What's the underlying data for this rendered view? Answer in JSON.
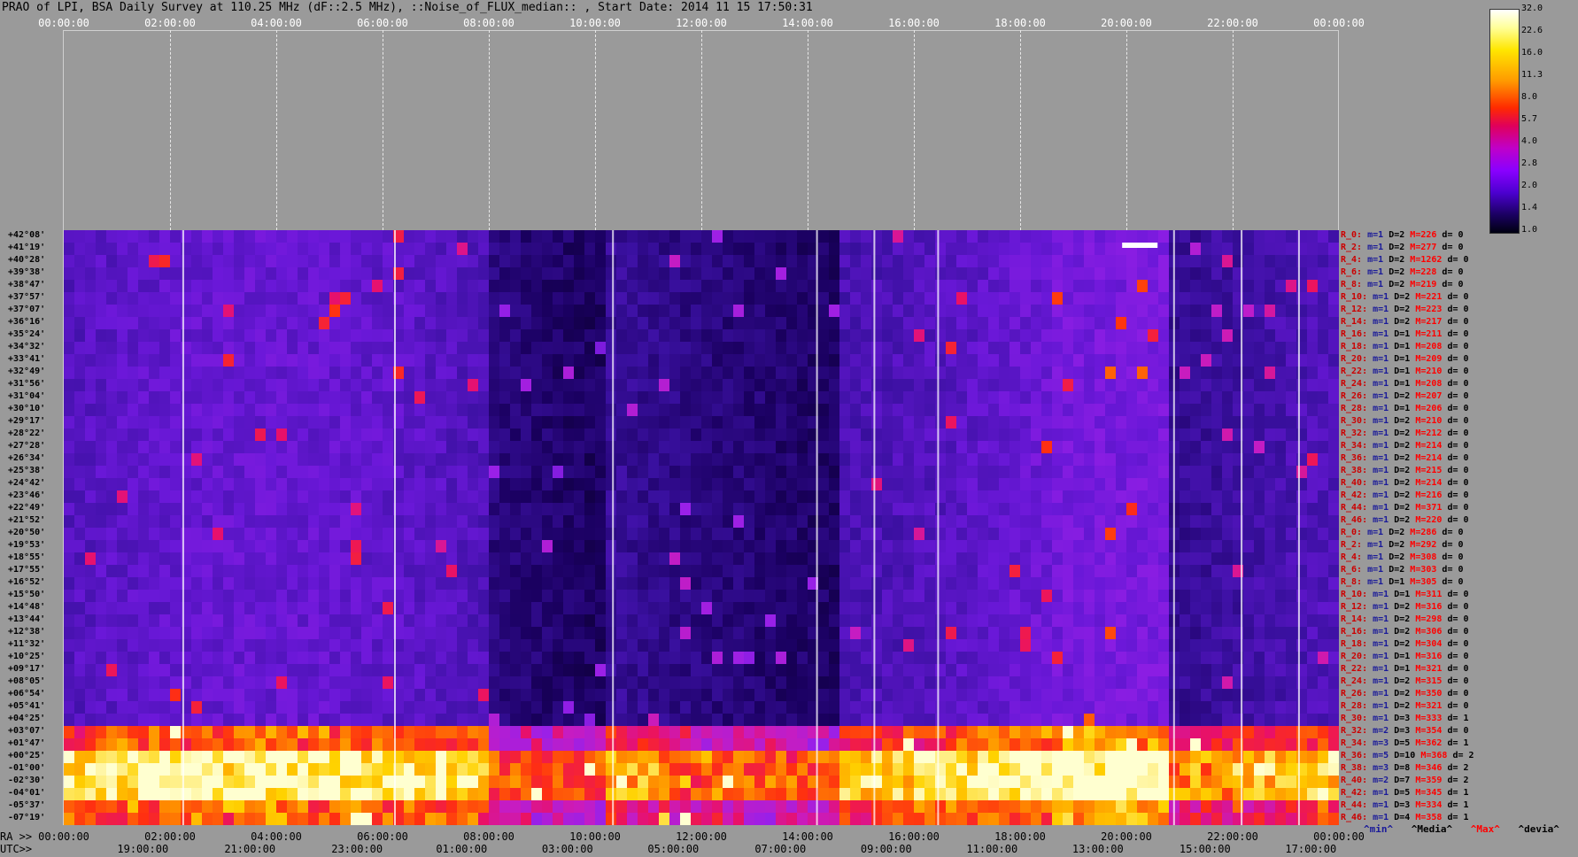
{
  "title": "PRAO of LPI, BSA Daily Survey at 110.25 MHz (dF::2.5 MHz), ::Noise_of_FLUX_median:: , Start Date: 2014 11 15 17:50:31",
  "top_axis_ticks": [
    "00:00:00",
    "02:00:00",
    "04:00:00",
    "06:00:00",
    "08:00:00",
    "10:00:00",
    "12:00:00",
    "14:00:00",
    "16:00:00",
    "18:00:00",
    "20:00:00",
    "22:00:00",
    "00:00:00"
  ],
  "ra_axis": {
    "label": "RA >>",
    "ticks": [
      "00:00:00",
      "02:00:00",
      "04:00:00",
      "06:00:00",
      "08:00:00",
      "10:00:00",
      "12:00:00",
      "14:00:00",
      "16:00:00",
      "18:00:00",
      "20:00:00",
      "22:00:00",
      "00:00:00"
    ]
  },
  "utc_axis": {
    "label": "UTC>>",
    "ticks": [
      "19:00:00",
      "21:00:00",
      "23:00:00",
      "01:00:00",
      "03:00:00",
      "05:00:00",
      "07:00:00",
      "09:00:00",
      "11:00:00",
      "13:00:00",
      "15:00:00",
      "17:00:00"
    ]
  },
  "legend_row": {
    "min": "^min^",
    "median": "^Media^",
    "max": "^Max^",
    "devia": "^devia^"
  },
  "colors": {
    "background": "#9a9a9a",
    "min": "#1a1a99",
    "max": "#ff0000",
    "row_index": "#cc0000"
  },
  "chart_data": {
    "type": "heatmap",
    "title": "PRAO of LPI, BSA Daily Survey at 110.25 MHz (dF::2.5 MHz), ::Noise_of_FLUX_median:: , Start Date: 2014 11 15 17:50:31",
    "x_axis": "RA 00:00:00 to 24:00:00",
    "colorbar": {
      "ticks": [
        "32.0",
        "22.6",
        "16.0",
        "11.3",
        "8.0",
        "5.7",
        "4.0",
        "2.8",
        "2.0",
        "1.4",
        "1.0"
      ],
      "scale": "log"
    },
    "declinations": [
      "+42°08'",
      "+41°19'",
      "+40°28'",
      "+39°38'",
      "+38°47'",
      "+37°57'",
      "+37°07'",
      "+36°16'",
      "+35°24'",
      "+34°32'",
      "+33°41'",
      "+32°49'",
      "+31°56'",
      "+31°04'",
      "+30°10'",
      "+29°17'",
      "+28°22'",
      "+27°28'",
      "+26°34'",
      "+25°38'",
      "+24°42'",
      "+23°46'",
      "+22°49'",
      "+21°52'",
      "+20°50'",
      "+19°53'",
      "+18°55'",
      "+17°55'",
      "+16°52'",
      "+15°50'",
      "+14°48'",
      "+13°44'",
      "+12°38'",
      "+11°32'",
      "+10°25'",
      "+09°17'",
      "+08°05'",
      "+06°54'",
      "+05°41'",
      "+04°25'",
      "+03°07'",
      "+01°47'",
      "+00°25'",
      "-01°00'",
      "-02°30'",
      "-04°01'",
      "-05°37'",
      "-07°19'"
    ],
    "row_stats": [
      {
        "r": "R_0:",
        "m": "m=1",
        "D": "D=2",
        "M": "M=226",
        "d": "d= 0"
      },
      {
        "r": "R_2:",
        "m": "m=1",
        "D": "D=2",
        "M": "M=277",
        "d": "d= 0"
      },
      {
        "r": "R_4:",
        "m": "m=1",
        "D": "D=2",
        "M": "M=1262",
        "d": "d= 0"
      },
      {
        "r": "R_6:",
        "m": "m=1",
        "D": "D=2",
        "M": "M=228",
        "d": "d= 0"
      },
      {
        "r": "R_8:",
        "m": "m=1",
        "D": "D=2",
        "M": "M=219",
        "d": "d= 0"
      },
      {
        "r": "R_10:",
        "m": "m=1",
        "D": "D=2",
        "M": "M=221",
        "d": "d= 0"
      },
      {
        "r": "R_12:",
        "m": "m=1",
        "D": "D=2",
        "M": "M=223",
        "d": "d= 0"
      },
      {
        "r": "R_14:",
        "m": "m=1",
        "D": "D=2",
        "M": "M=217",
        "d": "d= 0"
      },
      {
        "r": "R_16:",
        "m": "m=1",
        "D": "D=1",
        "M": "M=211",
        "d": "d= 0"
      },
      {
        "r": "R_18:",
        "m": "m=1",
        "D": "D=1",
        "M": "M=208",
        "d": "d= 0"
      },
      {
        "r": "R_20:",
        "m": "m=1",
        "D": "D=1",
        "M": "M=209",
        "d": "d= 0"
      },
      {
        "r": "R_22:",
        "m": "m=1",
        "D": "D=1",
        "M": "M=210",
        "d": "d= 0"
      },
      {
        "r": "R_24:",
        "m": "m=1",
        "D": "D=1",
        "M": "M=208",
        "d": "d= 0"
      },
      {
        "r": "R_26:",
        "m": "m=1",
        "D": "D=2",
        "M": "M=207",
        "d": "d= 0"
      },
      {
        "r": "R_28:",
        "m": "m=1",
        "D": "D=1",
        "M": "M=206",
        "d": "d= 0"
      },
      {
        "r": "R_30:",
        "m": "m=1",
        "D": "D=2",
        "M": "M=210",
        "d": "d= 0"
      },
      {
        "r": "R_32:",
        "m": "m=1",
        "D": "D=2",
        "M": "M=212",
        "d": "d= 0"
      },
      {
        "r": "R_34:",
        "m": "m=1",
        "D": "D=2",
        "M": "M=214",
        "d": "d= 0"
      },
      {
        "r": "R_36:",
        "m": "m=1",
        "D": "D=2",
        "M": "M=214",
        "d": "d= 0"
      },
      {
        "r": "R_38:",
        "m": "m=1",
        "D": "D=2",
        "M": "M=215",
        "d": "d= 0"
      },
      {
        "r": "R_40:",
        "m": "m=1",
        "D": "D=2",
        "M": "M=214",
        "d": "d= 0"
      },
      {
        "r": "R_42:",
        "m": "m=1",
        "D": "D=2",
        "M": "M=216",
        "d": "d= 0"
      },
      {
        "r": "R_44:",
        "m": "m=1",
        "D": "D=2",
        "M": "M=371",
        "d": "d= 0"
      },
      {
        "r": "R_46:",
        "m": "m=1",
        "D": "D=2",
        "M": "M=220",
        "d": "d= 0"
      },
      {
        "r": "R_0:",
        "m": "m=1",
        "D": "D=2",
        "M": "M=286",
        "d": "d= 0"
      },
      {
        "r": "R_2:",
        "m": "m=1",
        "D": "D=2",
        "M": "M=292",
        "d": "d= 0"
      },
      {
        "r": "R_4:",
        "m": "m=1",
        "D": "D=2",
        "M": "M=308",
        "d": "d= 0"
      },
      {
        "r": "R_6:",
        "m": "m=1",
        "D": "D=2",
        "M": "M=303",
        "d": "d= 0"
      },
      {
        "r": "R_8:",
        "m": "m=1",
        "D": "D=1",
        "M": "M=305",
        "d": "d= 0"
      },
      {
        "r": "R_10:",
        "m": "m=1",
        "D": "D=1",
        "M": "M=311",
        "d": "d= 0"
      },
      {
        "r": "R_12:",
        "m": "m=1",
        "D": "D=2",
        "M": "M=316",
        "d": "d= 0"
      },
      {
        "r": "R_14:",
        "m": "m=1",
        "D": "D=2",
        "M": "M=298",
        "d": "d= 0"
      },
      {
        "r": "R_16:",
        "m": "m=1",
        "D": "D=2",
        "M": "M=306",
        "d": "d= 0"
      },
      {
        "r": "R_18:",
        "m": "m=1",
        "D": "D=2",
        "M": "M=304",
        "d": "d= 0"
      },
      {
        "r": "R_20:",
        "m": "m=1",
        "D": "D=1",
        "M": "M=316",
        "d": "d= 0"
      },
      {
        "r": "R_22:",
        "m": "m=1",
        "D": "D=1",
        "M": "M=321",
        "d": "d= 0"
      },
      {
        "r": "R_24:",
        "m": "m=1",
        "D": "D=2",
        "M": "M=315",
        "d": "d= 0"
      },
      {
        "r": "R_26:",
        "m": "m=1",
        "D": "D=2",
        "M": "M=350",
        "d": "d= 0"
      },
      {
        "r": "R_28:",
        "m": "m=1",
        "D": "D=2",
        "M": "M=321",
        "d": "d= 0"
      },
      {
        "r": "R_30:",
        "m": "m=1",
        "D": "D=3",
        "M": "M=333",
        "d": "d= 1"
      },
      {
        "r": "R_32:",
        "m": "m=2",
        "D": "D=3",
        "M": "M=354",
        "d": "d= 0"
      },
      {
        "r": "R_34:",
        "m": "m=3",
        "D": "D=5",
        "M": "M=362",
        "d": "d= 1"
      },
      {
        "r": "R_36:",
        "m": "m=5",
        "D": "D=10",
        "M": "M=368",
        "d": "d= 2"
      },
      {
        "r": "R_38:",
        "m": "m=3",
        "D": "D=8",
        "M": "M=346",
        "d": "d= 2"
      },
      {
        "r": "R_40:",
        "m": "m=2",
        "D": "D=7",
        "M": "M=359",
        "d": "d= 2"
      },
      {
        "r": "R_42:",
        "m": "m=1",
        "D": "D=5",
        "M": "M=345",
        "d": "d= 1"
      },
      {
        "r": "R_44:",
        "m": "m=1",
        "D": "D=3",
        "M": "M=334",
        "d": "d= 1"
      },
      {
        "r": "R_46:",
        "m": "m=1",
        "D": "D=4",
        "M": "M=358",
        "d": "d= 1"
      }
    ]
  }
}
